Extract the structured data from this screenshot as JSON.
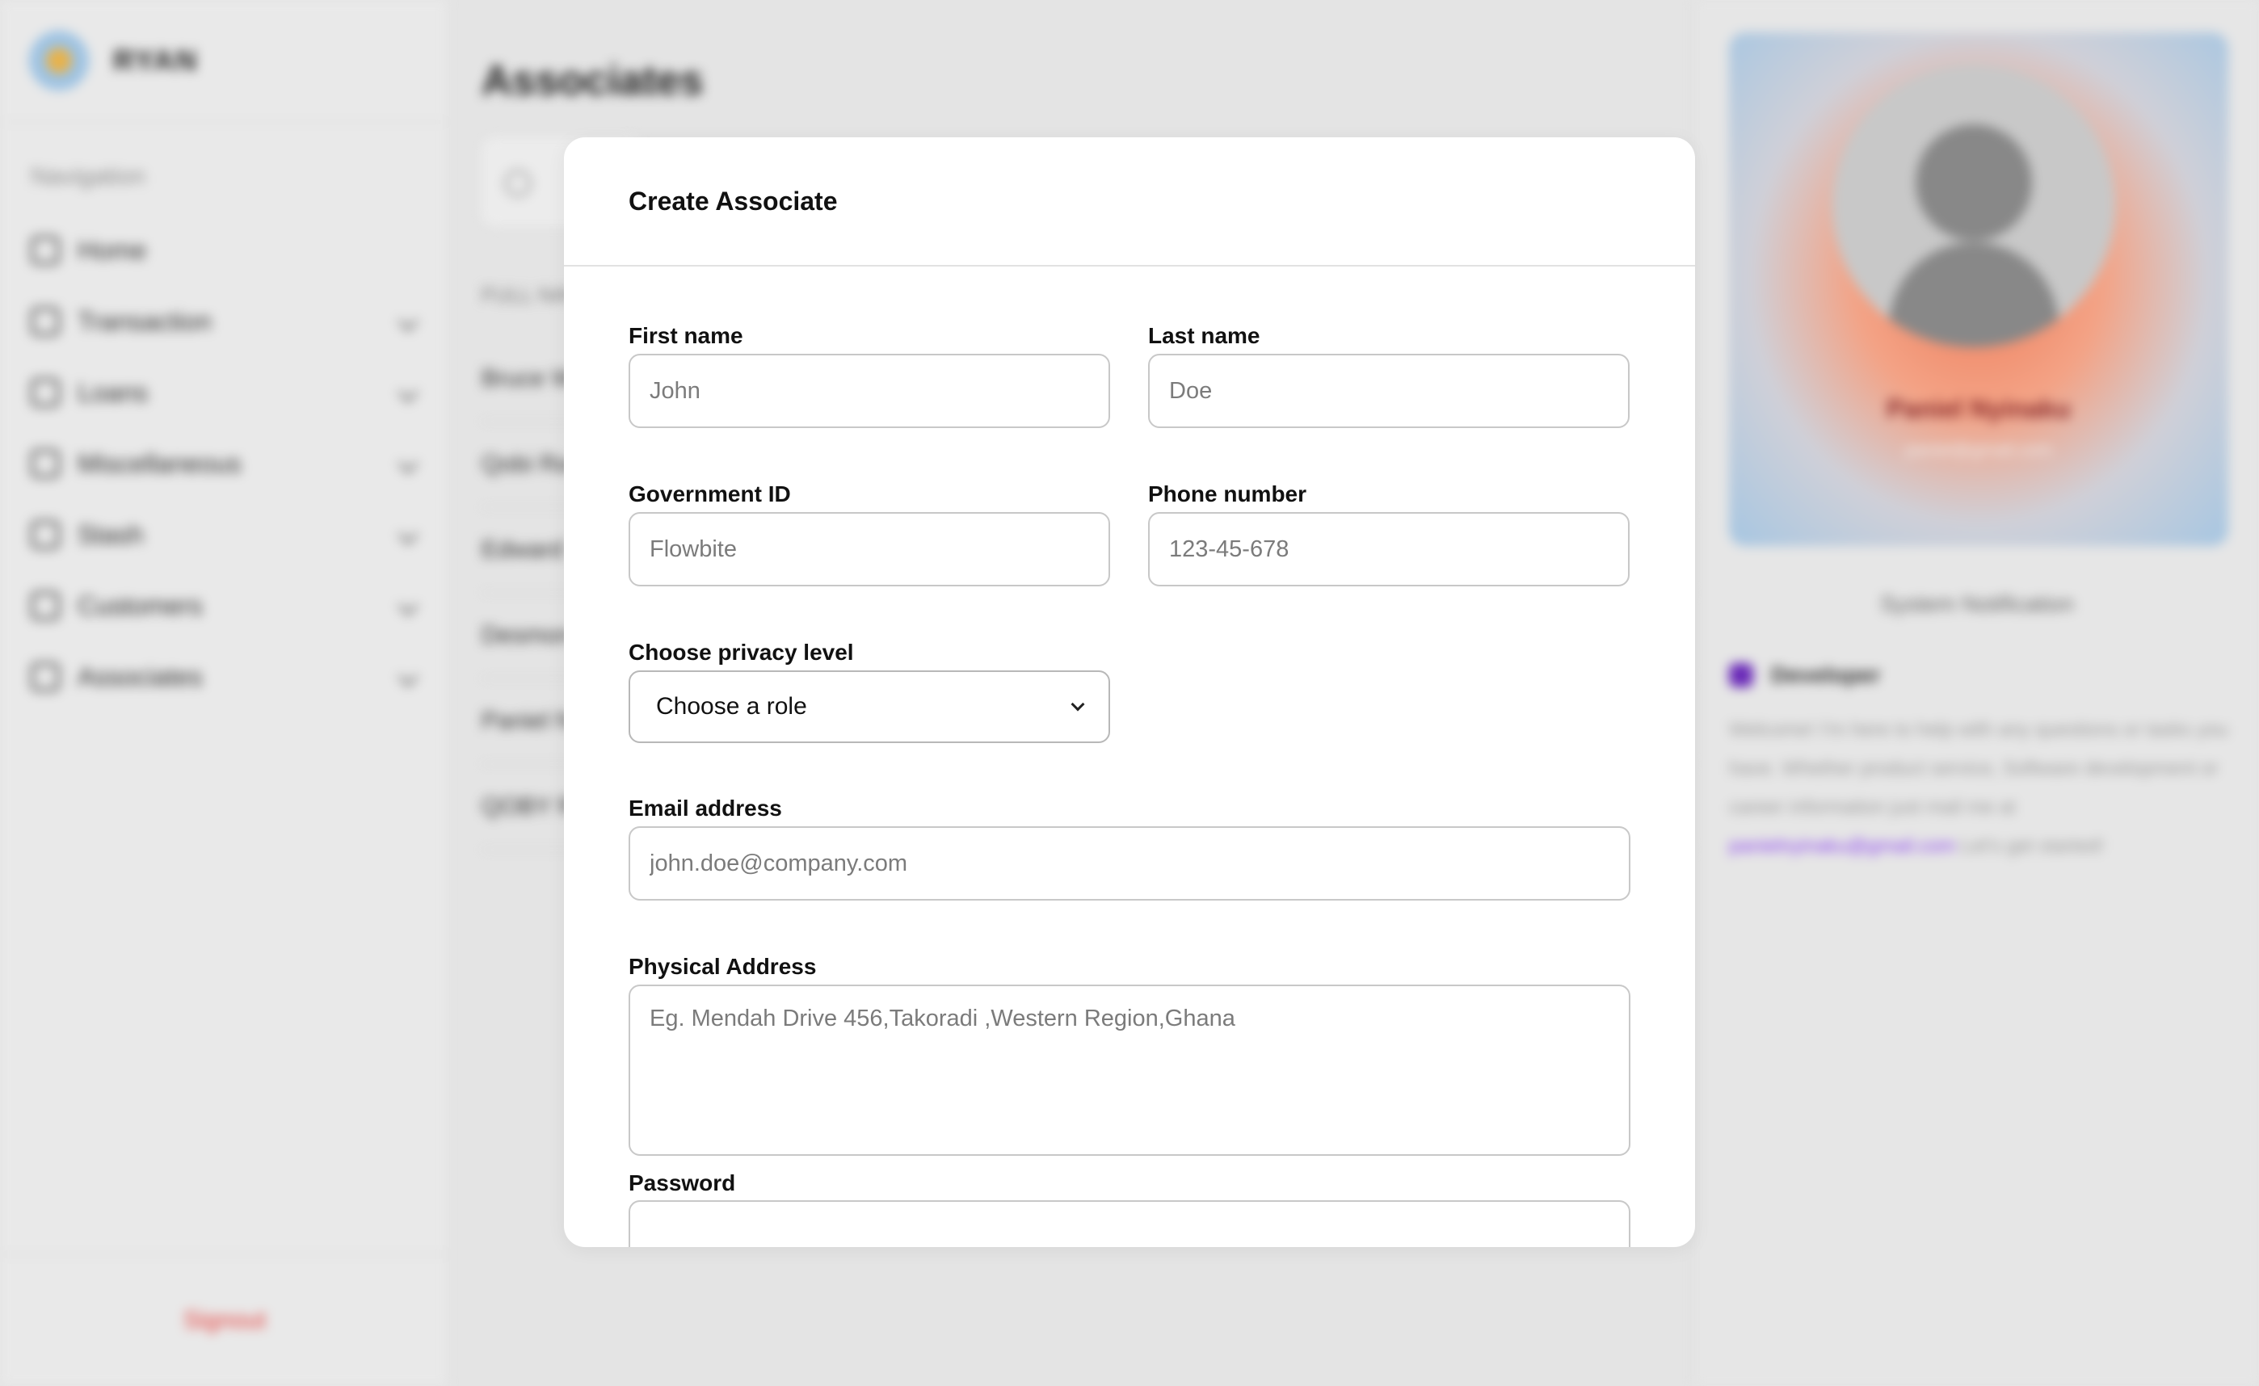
{
  "background": {
    "brand_name": "RYAN",
    "nav_heading": "Navigation",
    "nav_items": [
      {
        "label": "Home"
      },
      {
        "label": "Transaction"
      },
      {
        "label": "Loans"
      },
      {
        "label": "Miscellaneous"
      },
      {
        "label": "Stash"
      },
      {
        "label": "Customers"
      },
      {
        "label": "Associates"
      }
    ],
    "signout_label": "Signout",
    "page_title": "Associates",
    "column_header": "FULL NAME",
    "rows": [
      "Bruce W",
      "Qobi Ra",
      "Edward",
      "Desmon",
      "Paniel N",
      "QOBY R"
    ],
    "profile": {
      "name": "Paniel Nyinaku",
      "email": "paniel@gmail.com",
      "system_notification": "System Notification",
      "developer_label": "Developer",
      "developer_text": "Welcome! I'm here to help with any questions or tasks you have. Whether product service, Software development or career information just mail me at",
      "developer_email": "panielnyinaku@gmail.com",
      "developer_suffix": "Let's get started!"
    }
  },
  "modal": {
    "title": "Create Associate",
    "first_name": {
      "label": "First name",
      "placeholder": "John"
    },
    "last_name": {
      "label": "Last name",
      "placeholder": "Doe"
    },
    "government_id": {
      "label": "Government ID",
      "placeholder": "Flowbite"
    },
    "phone": {
      "label": "Phone number",
      "placeholder": "123-45-678"
    },
    "privacy": {
      "label": "Choose privacy level",
      "selected": "Choose a role"
    },
    "email": {
      "label": "Email address",
      "placeholder": "john.doe@company.com"
    },
    "address": {
      "label": "Physical Address",
      "placeholder": "Eg. Mendah Drive 456,Takoradi ,Western Region,Ghana"
    },
    "password": {
      "label": "Password"
    }
  },
  "colors": {
    "signout": "#e53935",
    "developer_accent": "#6a2ab8",
    "link": "#8a3ff0"
  }
}
